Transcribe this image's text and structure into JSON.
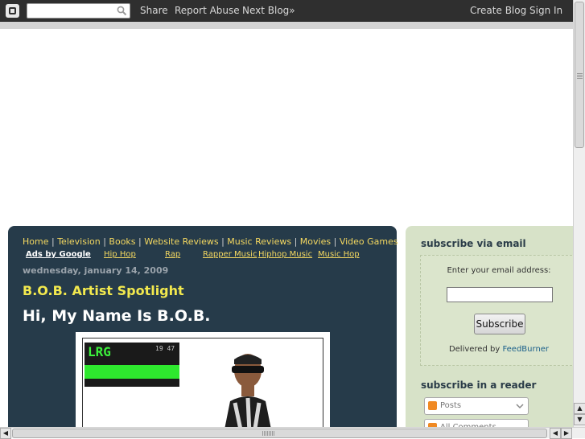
{
  "navbar": {
    "search_placeholder": "",
    "links": [
      "Share",
      "Report Abuse",
      "Next Blog»"
    ],
    "right_links": [
      "Create Blog",
      "Sign In"
    ]
  },
  "top_nav": {
    "items": [
      "Home",
      "Television",
      "Books",
      "Website Reviews",
      "Music Reviews",
      "Movies",
      "Video Games"
    ],
    "separator": "|"
  },
  "ads": {
    "label": "Ads by Google",
    "links": [
      "Hip Hop",
      "Rap",
      "Rapper Music",
      "Hiphop Music",
      "Music Hop"
    ]
  },
  "post": {
    "date": "wednesday, january 14, 2009",
    "title": "B.O.B. Artist Spotlight",
    "heading": "Hi, My Name Is B.O.B.",
    "image_text": {
      "brand": "LRG",
      "number": "19 47"
    }
  },
  "sidebar": {
    "email_title": "subscribe via email",
    "email_label": "Enter your email address:",
    "subscribe_button": "Subscribe",
    "delivered_by": "Delivered by",
    "feedburner": "FeedBurner",
    "reader_title": "subscribe in a reader",
    "reader_options": [
      "Posts",
      "All Comments"
    ]
  },
  "colors": {
    "panel_bg": "#263b4a",
    "link_yellow": "#f4d860",
    "title_yellow": "#f2e94e",
    "sidebar_bg": "#d7e2c8"
  }
}
